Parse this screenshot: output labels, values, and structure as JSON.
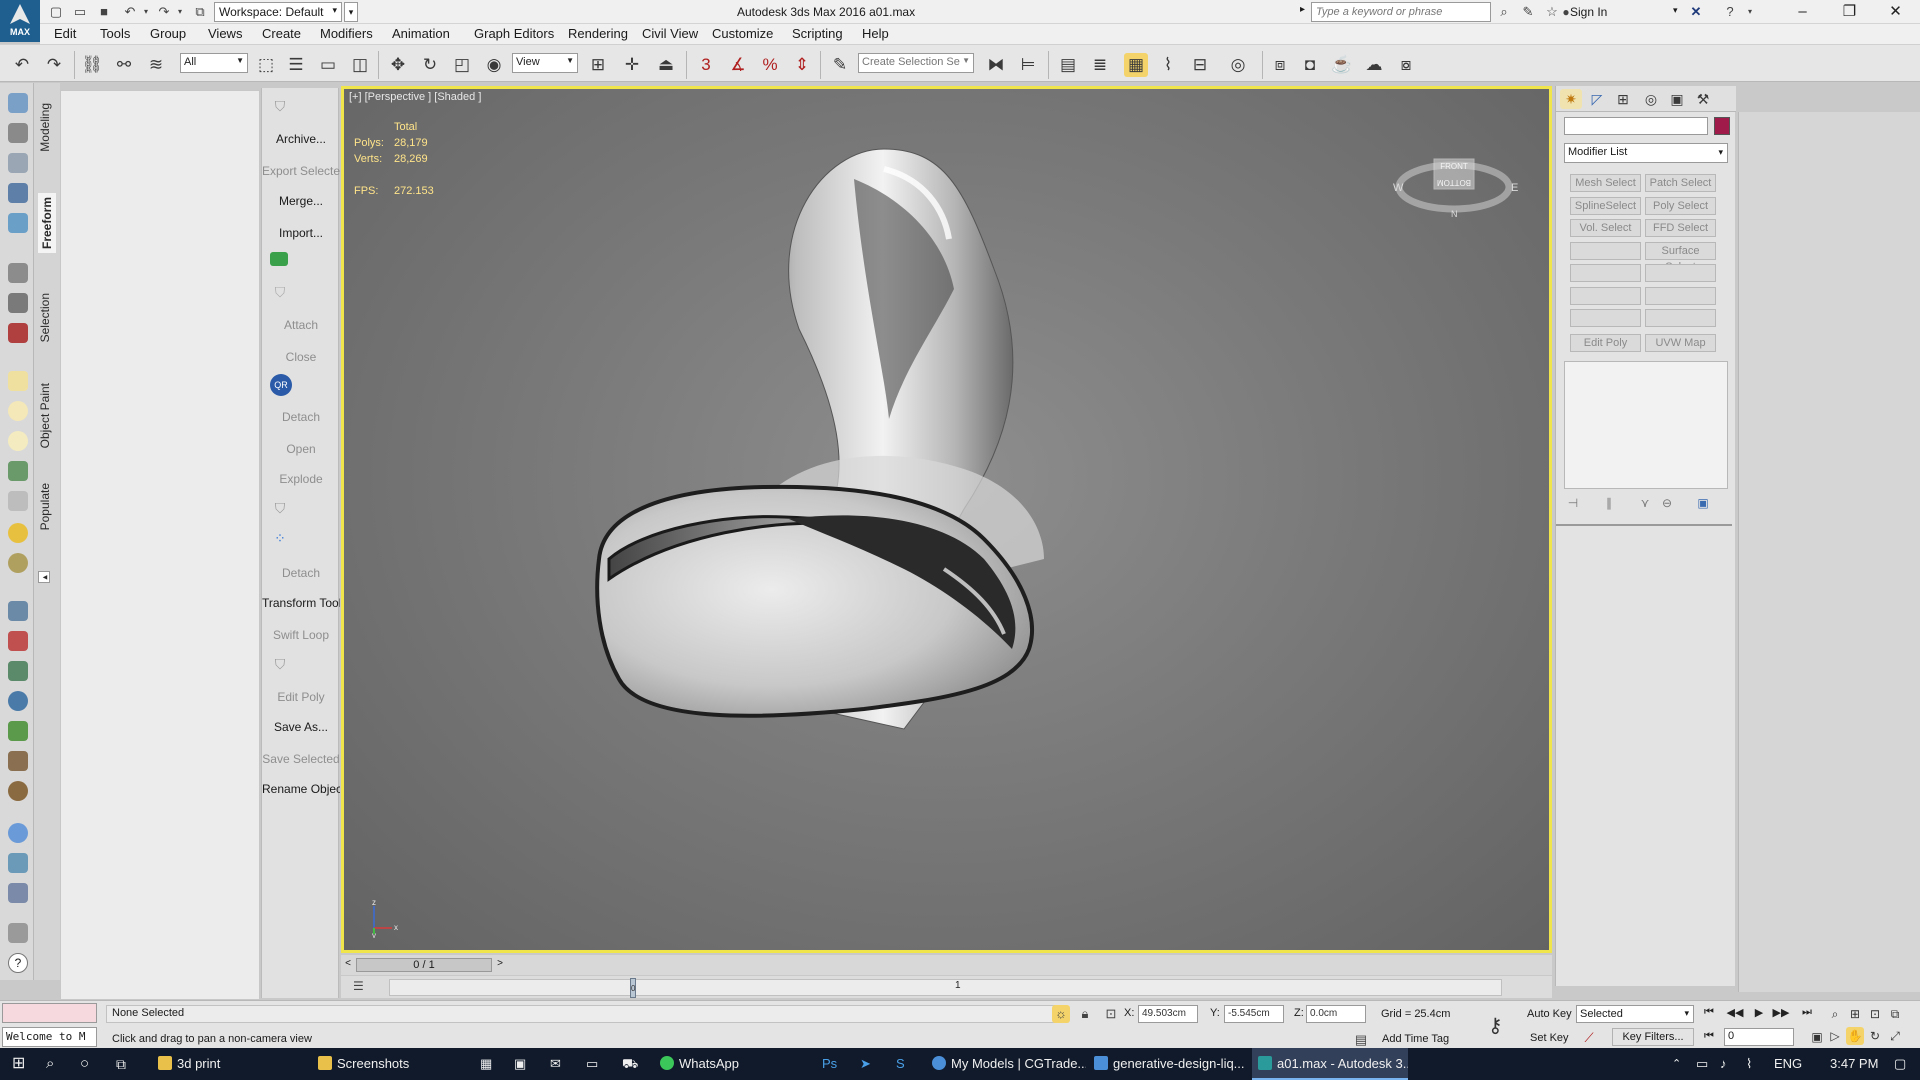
{
  "titlebar": {
    "app_logo": "MAX",
    "workspace": "Workspace: Default",
    "title": "Autodesk 3ds Max 2016     a01.max",
    "search_placeholder": "Type a keyword or phrase",
    "sign_in": "Sign In"
  },
  "menu": [
    "Edit",
    "Tools",
    "Group",
    "Views",
    "Create",
    "Modifiers",
    "Animation",
    "Graph Editors",
    "Rendering",
    "Civil View",
    "Customize",
    "Scripting",
    "Help"
  ],
  "toolbar": {
    "selection_filter": "All",
    "ref_coord": "View",
    "named_selection": "Create Selection Se"
  },
  "ribbon_tabs": [
    "Modeling",
    "Freeform",
    "Selection",
    "Object Paint",
    "Populate"
  ],
  "tool_column": [
    {
      "label": "Archive...",
      "dim": false
    },
    {
      "label": "Export Selected",
      "dim": true
    },
    {
      "label": "Merge...",
      "dim": false
    },
    {
      "label": "Import...",
      "dim": false
    },
    {
      "label": "Attach",
      "dim": true
    },
    {
      "label": "Close",
      "dim": true
    },
    {
      "label": "Detach",
      "dim": true
    },
    {
      "label": "Open",
      "dim": true
    },
    {
      "label": "Explode",
      "dim": true
    },
    {
      "label": "Detach",
      "dim": true
    },
    {
      "label": "Transform Tool",
      "dim": false
    },
    {
      "label": "Swift Loop",
      "dim": true
    },
    {
      "label": "Edit Poly",
      "dim": true
    },
    {
      "label": "Save As...",
      "dim": false
    },
    {
      "label": "Save Selected",
      "dim": true
    },
    {
      "label": "Rename Objects",
      "dim": false
    }
  ],
  "viewport": {
    "label": "[+] [Perspective ] [Shaded ]",
    "stats": {
      "header": "Total",
      "polys_label": "Polys:",
      "polys": "28,179",
      "verts_label": "Verts:",
      "verts": "28,269",
      "fps_label": "FPS:",
      "fps": "272.153"
    },
    "viewcube": {
      "top": "FRONT",
      "face": "BOTTOM",
      "west": "W",
      "east": "E",
      "north": "N"
    },
    "axes": {
      "x": "x",
      "y": "y",
      "z": "z"
    }
  },
  "command_panel": {
    "modifier_list": "Modifier List",
    "object_color": "#a01a4a",
    "buttons": [
      [
        "Mesh Select",
        "Patch Select"
      ],
      [
        "SplineSelect",
        "Poly Select"
      ],
      [
        "Vol. Select",
        "FFD Select"
      ],
      [
        "",
        "Surface Select"
      ],
      [
        "",
        ""
      ],
      [
        "",
        ""
      ],
      [
        "",
        ""
      ],
      [
        "Edit Poly",
        "UVW Map"
      ]
    ]
  },
  "time_slider": {
    "frame": "0 / 1",
    "prev": "<",
    "next": ">"
  },
  "trackbar": {
    "tick_1": "1",
    "marker": "0"
  },
  "status": {
    "selection": "None Selected",
    "prompt": "Click and drag to pan a non-camera view",
    "listener_text": "Welcome to M",
    "x_label": "X:",
    "x": "49.503cm",
    "y_label": "Y:",
    "y": "-5.545cm",
    "z_label": "Z:",
    "z": "0.0cm",
    "grid": "Grid = 25.4cm",
    "add_time_tag": "Add Time Tag",
    "auto_key": "Auto Key",
    "set_key": "Set Key",
    "key_mode": "Selected",
    "key_filters": "Key Filters...",
    "current_frame": "0"
  },
  "taskbar": {
    "apps": [
      {
        "label": "3d print",
        "color": "#e8c04a"
      },
      {
        "label": "Screenshots",
        "color": "#e8c04a"
      },
      {
        "label": "WhatsApp",
        "color": "#3cc75a"
      },
      {
        "label": "My Models | CGTrade...",
        "color": "#4a8fd8"
      },
      {
        "label": "generative-design-liq...",
        "color": "#4a8fd8"
      },
      {
        "label": "a01.max - Autodesk 3...",
        "color": "#2a9a9a"
      }
    ],
    "lang": "ENG",
    "time": "3:47 PM"
  }
}
